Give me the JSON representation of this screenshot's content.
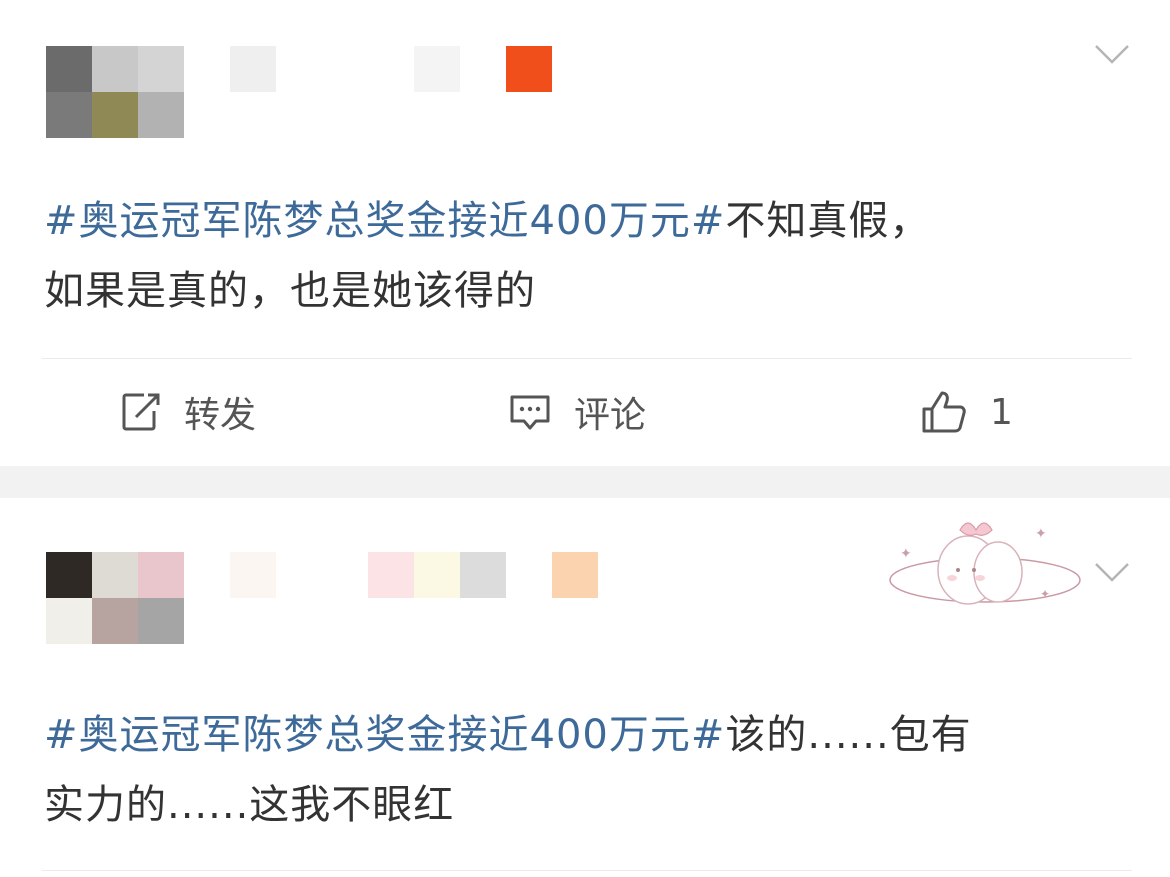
{
  "posts": [
    {
      "hashtag": "#奥运冠军陈梦总奖金接近400万元#",
      "text_line1": "不知真假，",
      "text_line2": "如果是真的，也是她该得的",
      "avatar_colors": [
        "#6b6b6b",
        "#c8c8c8",
        "#d4d4d4",
        "#7a7a7a",
        "#8f8a55",
        "#b2b2b2"
      ],
      "name_blur_colors": [
        "#efefef",
        "#ffffff",
        "#f4f4f4",
        "#f04f1c"
      ],
      "actions": {
        "repost": {
          "label": "转发",
          "icon": "share-icon"
        },
        "comment": {
          "label": "评论",
          "icon": "comment-icon"
        },
        "like": {
          "label": "1",
          "icon": "thumbs-up-icon"
        }
      }
    },
    {
      "hashtag": "#奥运冠军陈梦总奖金接近400万元#",
      "text_line1": "该的......包有",
      "text_line2": "实力的......这我不眼红",
      "avatar_colors": [
        "#2e2925",
        "#dedbd5",
        "#e9c6cb",
        "#f1efe9",
        "#b7a4a0",
        "#a5a5a5"
      ],
      "name_blur_colors": [
        "#fcf6f2",
        "#fbe3e6",
        "#fbf8e4",
        "#dcdcdc",
        "#fbd3ae"
      ],
      "sticker": "bunny-sticker-icon"
    }
  ],
  "colors": {
    "hashtag": "#3e6a99",
    "text": "#333333",
    "separator": "#f2f2f2"
  }
}
